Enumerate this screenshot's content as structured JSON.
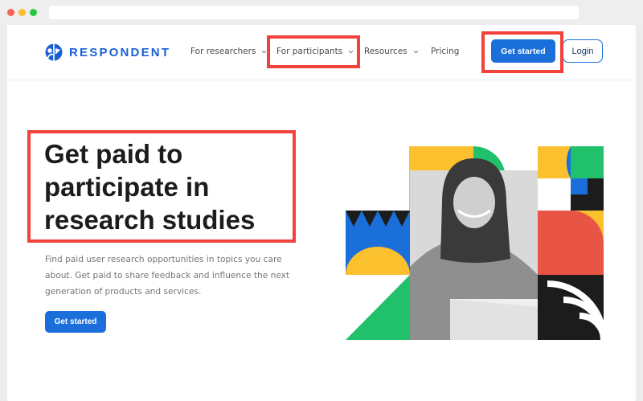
{
  "nav": {
    "brand": "RESPONDENT",
    "items": [
      {
        "label": "For researchers",
        "has_dropdown": true
      },
      {
        "label": "For participants",
        "has_dropdown": true
      },
      {
        "label": "Resources",
        "has_dropdown": true
      },
      {
        "label": "Pricing",
        "has_dropdown": false
      }
    ],
    "get_started": "Get started",
    "login": "Login"
  },
  "hero": {
    "headline_lines": [
      "Get paid to",
      "participate in",
      "research studies"
    ],
    "sub_lines": [
      "Find paid user research opportunities in topics you care",
      "about. Get paid to share feedback and influence the next",
      "generation of products and services."
    ],
    "cta": "Get started"
  },
  "colors": {
    "brand_blue": "#1a6fdb",
    "highlight_red": "#f2423b",
    "yellow": "#fbc02d",
    "green": "#21c06b",
    "coral": "#e85545"
  }
}
